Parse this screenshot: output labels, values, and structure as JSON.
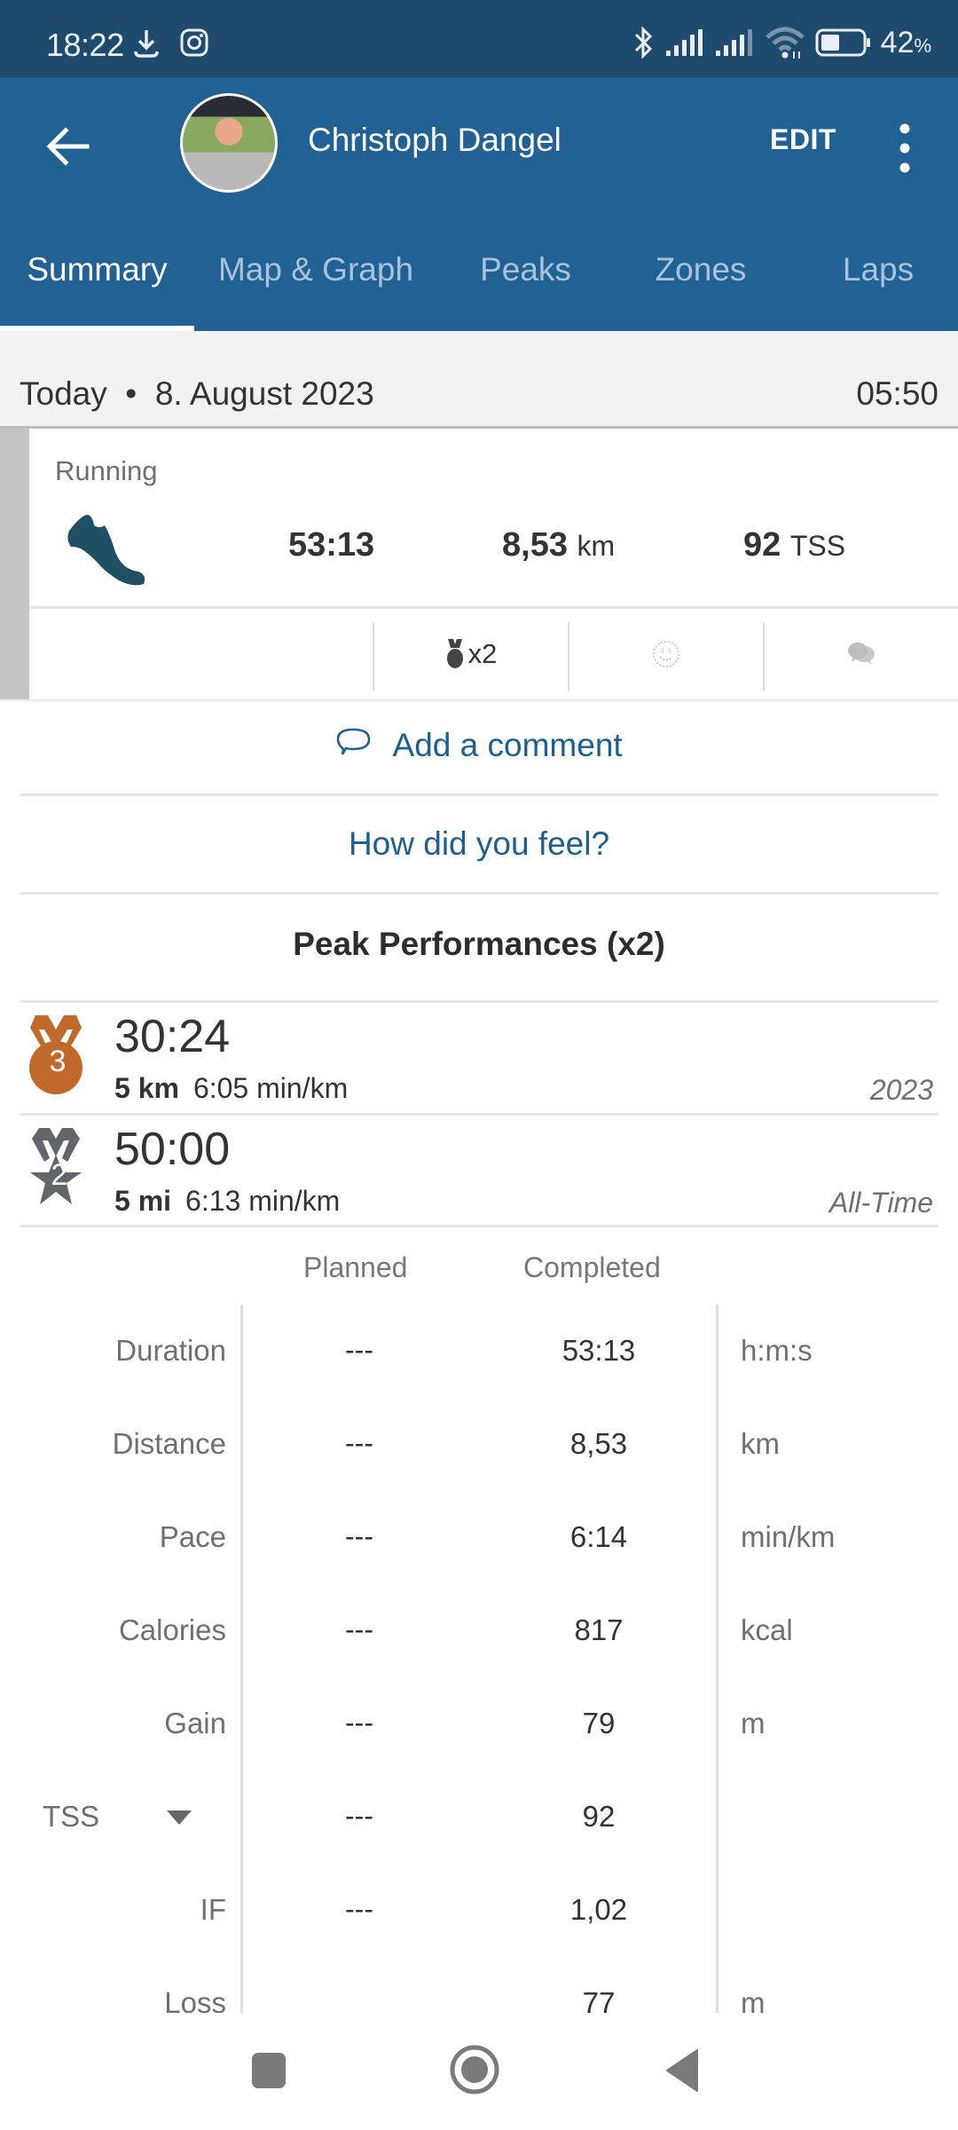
{
  "status_bar": {
    "time": "18:22",
    "left_icons": [
      "download-icon",
      "instagram-icon"
    ],
    "right_icons": [
      "bluetooth-icon",
      "signal-icon",
      "signal-icon",
      "wifi-icon",
      "battery-icon"
    ],
    "battery_percent": "42",
    "battery_suffix": "%",
    "battery_level": 0.42
  },
  "app_bar": {
    "back_icon": "arrow-left-icon",
    "user_name": "Christoph Dangel",
    "edit_label": "EDIT",
    "more_icon": "more-vertical-icon"
  },
  "tabs": [
    {
      "label": "Summary",
      "active": true
    },
    {
      "label": "Map & Graph",
      "active": false
    },
    {
      "label": "Peaks",
      "active": false
    },
    {
      "label": "Zones",
      "active": false
    },
    {
      "label": "Laps",
      "active": false
    }
  ],
  "date_header": {
    "day": "Today",
    "separator": "•",
    "date": "8. August 2023",
    "time": "05:50"
  },
  "activity": {
    "sport": "Running",
    "sport_icon": "running-shoe-icon",
    "duration": "53:13",
    "distance_value": "8,53",
    "distance_unit": "km",
    "tss_value": "92",
    "tss_unit": "TSS",
    "medal_count": "x2",
    "feel_icon": "smiley-outline-icon",
    "comments_icon": "comments-icon"
  },
  "links": {
    "add_comment": "Add a comment",
    "how_feel": "How did you feel?"
  },
  "peak_performances": {
    "title": "Peak Performances (x2)",
    "items": [
      {
        "rank": "3",
        "medal": "bronze",
        "time": "30:24",
        "distance": "5 km",
        "pace": "6:05 min/km",
        "scope": "2023",
        "color": "#c0692a"
      },
      {
        "rank": "2",
        "medal": "silver-star",
        "time": "50:00",
        "distance": "5 mi",
        "pace": "6:13 min/km",
        "scope": "All-Time",
        "color": "#63656b"
      }
    ]
  },
  "stats_table": {
    "headers": {
      "planned": "Planned",
      "completed": "Completed"
    },
    "rows": [
      {
        "label": "Duration",
        "planned": "---",
        "completed": "53:13",
        "unit": "h:m:s"
      },
      {
        "label": "Distance",
        "planned": "---",
        "completed": "8,53",
        "unit": "km"
      },
      {
        "label": "Pace",
        "planned": "---",
        "completed": "6:14",
        "unit": "min/km"
      },
      {
        "label": "Calories",
        "planned": "---",
        "completed": "817",
        "unit": "kcal"
      },
      {
        "label": "Gain",
        "planned": "---",
        "completed": "79",
        "unit": "m"
      },
      {
        "label": "TSS",
        "planned": "---",
        "completed": "92",
        "unit": "",
        "dropdown": true
      },
      {
        "label": "IF",
        "planned": "---",
        "completed": "1,02",
        "unit": ""
      },
      {
        "label": "Loss",
        "planned": "",
        "completed": "77",
        "unit": "m"
      }
    ]
  },
  "nav_bar": {
    "buttons": [
      "recents-icon",
      "home-icon",
      "back-icon"
    ]
  },
  "colors": {
    "status_bar": "#1e4a6e",
    "app_bar": "#216194",
    "link": "#1e5f8f",
    "shoe": "#1f4f62",
    "bronze": "#c0692a",
    "silver": "#63656b"
  }
}
